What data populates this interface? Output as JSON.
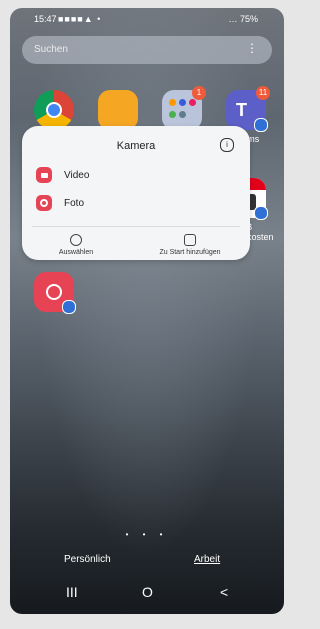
{
  "status_bar": {
    "time": "15:47",
    "notification_icons": "■■■■▲ •",
    "battery": "… 75%"
  },
  "search": {
    "placeholder": "Suchen"
  },
  "apps": [
    {
      "id": "chrome",
      "label": "",
      "badge": ""
    },
    {
      "id": "folder-yellow",
      "label": "",
      "badge": ""
    },
    {
      "id": "app-folder",
      "label": "",
      "badge": "1"
    },
    {
      "id": "teams",
      "label": "Teams",
      "badge": "11"
    },
    {
      "id": "db-reisekosten",
      "label": "DB Reisekosten",
      "badge": ""
    },
    {
      "id": "camera",
      "label": "",
      "badge": ""
    }
  ],
  "popup": {
    "title": "Kamera",
    "options": [
      {
        "label": "Video"
      },
      {
        "label": "Foto"
      }
    ],
    "actions": [
      {
        "label": "Auswählen"
      },
      {
        "label": "Zu Start hinzufügen"
      }
    ]
  },
  "pager": {
    "dots": "• • •"
  },
  "tabs": [
    {
      "label": "Persönlich"
    },
    {
      "label": "Arbeit"
    }
  ],
  "navbar": {
    "recents": "III",
    "home": "O",
    "back": "<"
  },
  "colors": {
    "badge": "#ef5b3a",
    "work_badge": "#2f6fd6",
    "camera": "#e64455"
  }
}
